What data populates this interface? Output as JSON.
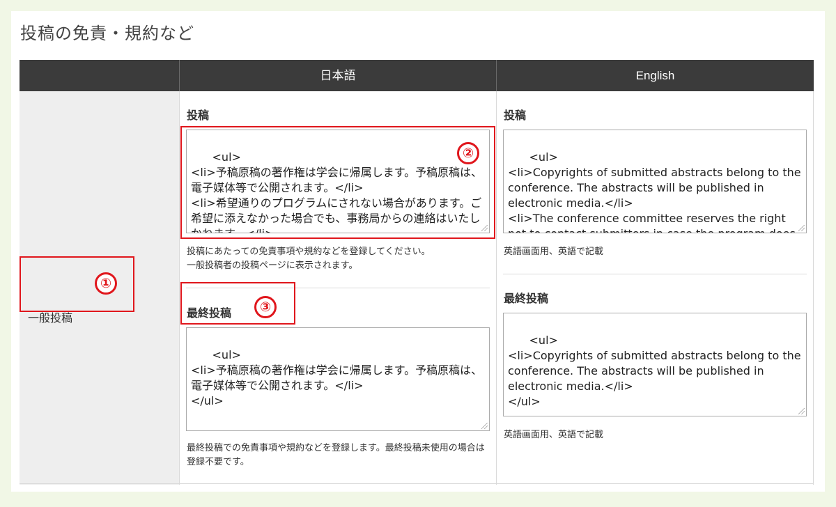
{
  "page": {
    "title": "投稿の免責・規約など"
  },
  "table": {
    "headers": [
      "",
      "日本語",
      "English"
    ],
    "row_label": "一般投稿"
  },
  "ja": {
    "submission": {
      "label": "投稿",
      "value": "<ul>\n<li>予稿原稿の著作権は学会に帰属します。予稿原稿は、電子媒体等で公開されます。</li>\n<li>希望通りのプログラムにされない場合があります。ご希望に添えなかった場合でも、事務局からの連絡はいたしかねます。</li>\n</ul>",
      "help": "投稿にあたっての免責事項や規約などを登録してください。\n一般投稿者の投稿ページに表示されます。"
    },
    "final": {
      "label": "最終投稿",
      "value": "<ul>\n<li>予稿原稿の著作権は学会に帰属します。予稿原稿は、電子媒体等で公開されます。</li>\n</ul>",
      "help": "最終投稿での免責事項や規約などを登録します。最終投稿未使用の場合は登録不要です。"
    }
  },
  "en": {
    "submission": {
      "label": "投稿",
      "value": "<ul>\n<li>Copyrights of submitted abstracts belong to the conference. The abstracts will be published in electronic media.</li>\n<li>The conference committee reserves the right not to contact submitters in case the program does not meet the requests for presentation order.</li>\n</ul>",
      "help": "英語画面用、英語で記載"
    },
    "final": {
      "label": "最終投稿",
      "value": "<ul>\n<li>Copyrights of submitted abstracts belong to the conference. The abstracts will be published in electronic media.</li>\n</ul>",
      "help": "英語画面用、英語で記載"
    }
  },
  "annotations": [
    "①",
    "②",
    "③"
  ],
  "colors": {
    "annotation": "#e0161c",
    "header_bg": "#3b3b3b",
    "page_bg": "#f1f7e6"
  }
}
